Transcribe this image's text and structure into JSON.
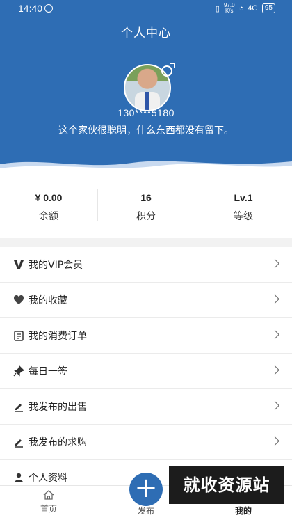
{
  "status_bar": {
    "time": "14:40",
    "network_speed_value": "97.0",
    "network_speed_unit": "K/s",
    "signal": "4G",
    "battery": "95"
  },
  "header": {
    "title": "个人中心",
    "phone": "130****5180",
    "motto": "这个家伙很聪明，什么东西都没有留下。",
    "bg_color": "#2e6db4"
  },
  "stats": [
    {
      "value": "¥ 0.00",
      "label": "余额"
    },
    {
      "value": "16",
      "label": "积分"
    },
    {
      "value": "Lv.1",
      "label": "等级"
    }
  ],
  "menu": [
    {
      "label": "我的VIP会员",
      "icon": "vip-icon"
    },
    {
      "label": "我的收藏",
      "icon": "heart-icon"
    },
    {
      "label": "我的消费订单",
      "icon": "order-icon"
    },
    {
      "label": "每日一签",
      "icon": "pin-icon"
    },
    {
      "label": "我发布的出售",
      "icon": "edit-icon"
    },
    {
      "label": "我发布的求购",
      "icon": "edit-icon"
    },
    {
      "label": "个人资料",
      "icon": "person-icon"
    }
  ],
  "tabbar": {
    "home": "首页",
    "publish": "发布",
    "mine": "我的"
  },
  "watermark": "就收资源站"
}
